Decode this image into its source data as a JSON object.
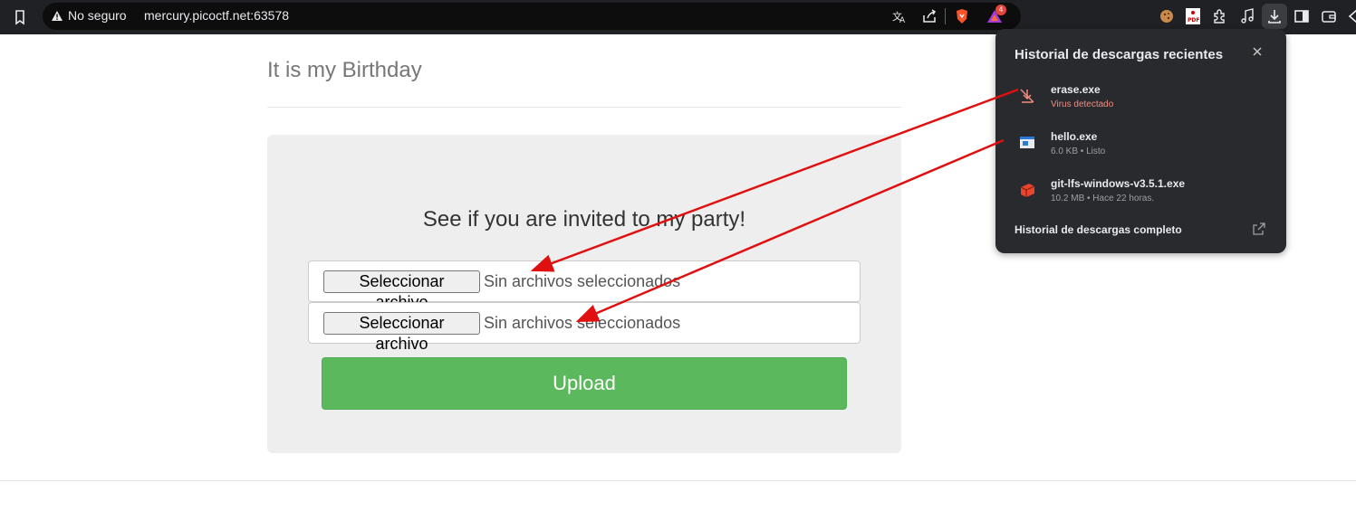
{
  "browser": {
    "security_label": "No seguro",
    "url": "mercury.picoctf.net:63578",
    "extension_badge_count": "4",
    "icons": [
      "bookmark-icon",
      "warning-icon",
      "translate-icon",
      "share-icon",
      "brave-icon",
      "brave-rewards-icon",
      "cookie-icon",
      "pdf-icon",
      "extensions-icon",
      "media-icon",
      "download-icon",
      "sidebar-icon",
      "wallet-icon"
    ]
  },
  "page": {
    "title": "It is my Birthday",
    "invite_text": "See if you are invited to my party!",
    "file_inputs": [
      {
        "button_label": "Seleccionar archivo",
        "status": "Sin archivos seleccionados"
      },
      {
        "button_label": "Seleccionar archivo",
        "status": "Sin archivos seleccionados"
      }
    ],
    "upload_label": "Upload"
  },
  "downloads": {
    "title": "Historial de descargas recientes",
    "items": [
      {
        "name": "erase.exe",
        "status": "Virus detectado"
      },
      {
        "name": "hello.exe",
        "status": "6.0 KB • Listo"
      },
      {
        "name": "git-lfs-windows-v3.5.1.exe",
        "status": "10.2 MB • Hace 22 horas."
      }
    ],
    "full_history_label": "Historial de descargas completo"
  },
  "colors": {
    "toolbar": "#202124",
    "panel": "#eeeeee",
    "upload": "#5cb85c",
    "popup": "#292a2d",
    "annotation_arrow": "#e01010",
    "danger_text": "#f28b82"
  }
}
